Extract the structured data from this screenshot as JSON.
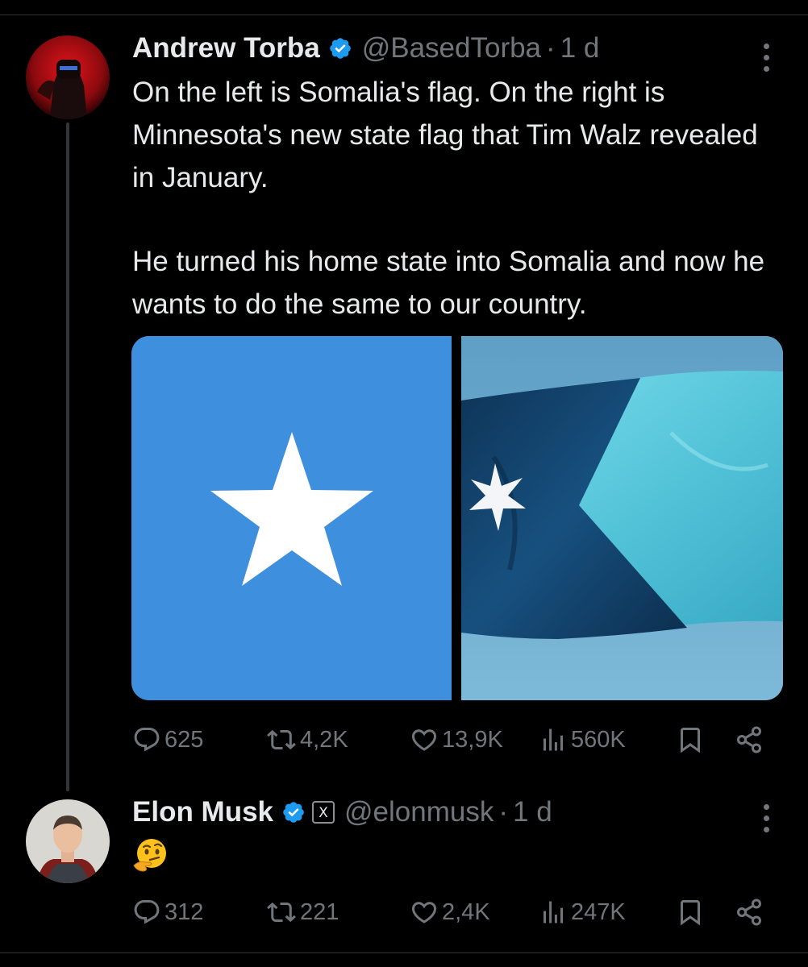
{
  "tweets": [
    {
      "author": {
        "name": "Andrew Torba",
        "handle": "@BasedTorba",
        "verified": true
      },
      "time": "1 d",
      "text_paragraphs": [
        "On the left is Somalia's flag. On the right is Minnesota's new state flag that Tim Walz revealed in January.",
        "He turned his home state into Somalia and now he wants to do the same to our country."
      ],
      "media": [
        {
          "description_icon": "somalia-flag",
          "colors": {
            "field": "#3e8fde",
            "star": "#ffffff"
          }
        },
        {
          "description_icon": "minnesota-flag",
          "colors": {
            "dark": "#0e3b63",
            "light": "#56c1d6",
            "star": "#ffffff"
          }
        }
      ],
      "stats": {
        "replies": "625",
        "reposts": "4,2K",
        "likes": "13,9K",
        "views": "560K"
      }
    },
    {
      "author": {
        "name": "Elon Musk",
        "handle": "@elonmusk",
        "verified": true,
        "affiliate_badge": "X"
      },
      "time": "1 d",
      "text_emoji": "thinking-face",
      "stats": {
        "replies": "312",
        "reposts": "221",
        "likes": "2,4K",
        "views": "247K"
      }
    }
  ],
  "colors": {
    "background": "#000000",
    "text": "#e7e9ea",
    "muted": "#71767b",
    "verified": "#1d9bf0"
  },
  "icons": [
    "reply-icon",
    "repost-icon",
    "like-icon",
    "views-icon",
    "bookmark-icon",
    "share-icon",
    "more-icon",
    "verified-badge-icon"
  ]
}
